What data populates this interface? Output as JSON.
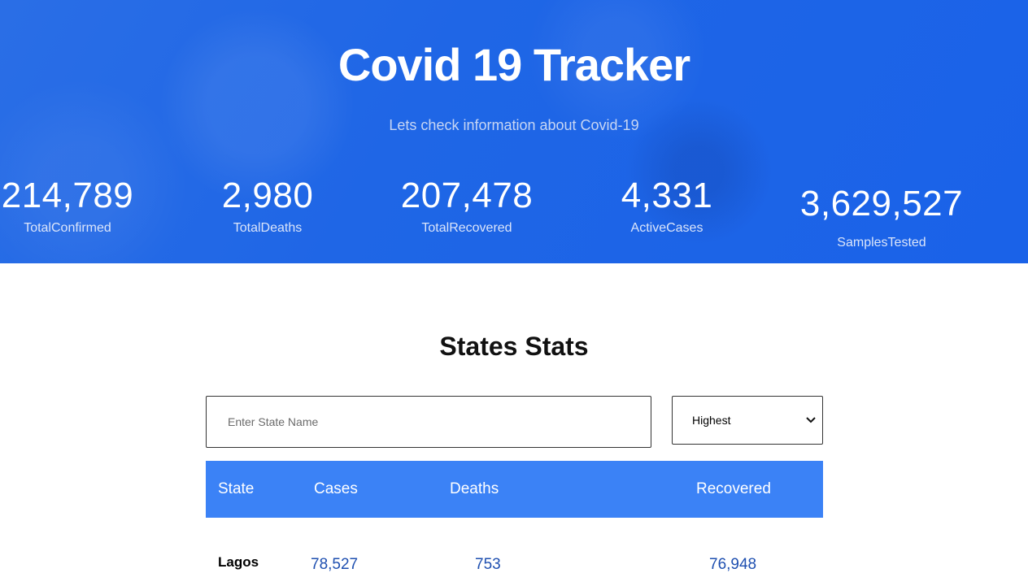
{
  "hero": {
    "title": "Covid 19 Tracker",
    "subtitle": "Lets check information about Covid-19",
    "background_color": "#1f66e6",
    "stats": [
      {
        "value": "214,789",
        "label": "TotalConfirmed"
      },
      {
        "value": "2,980",
        "label": "TotalDeaths"
      },
      {
        "value": "207,478",
        "label": "TotalRecovered"
      },
      {
        "value": "4,331",
        "label": "ActiveCases"
      },
      {
        "value": "3,629,527",
        "label": "SamplesTested"
      }
    ]
  },
  "states": {
    "title": "States Stats",
    "search_placeholder": "Enter State Name",
    "sort_selected": "Highest",
    "header_color": "#3b82f6",
    "columns": [
      "State",
      "Cases",
      "Deaths",
      "Recovered"
    ],
    "rows": [
      {
        "state": "Lagos",
        "cases": "78,527",
        "deaths": "753",
        "recovered": "76,948"
      }
    ]
  }
}
